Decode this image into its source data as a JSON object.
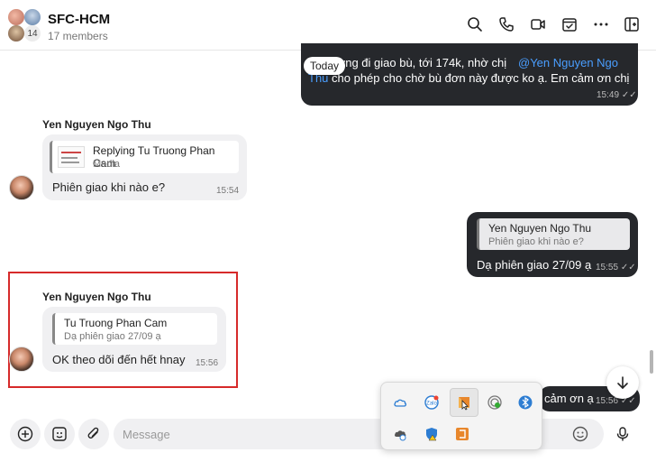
{
  "header": {
    "title": "SFC-HCM",
    "members": "17 members",
    "avatar_count": "14"
  },
  "messages": {
    "top_out": {
      "line1": "ường đi giao bù, tới 174k, nhờ chị",
      "mention1": "@Yen Nguyen Ngo",
      "mention2": "Thu",
      "line2": " cho phép cho chờ bù đơn này được ko ạ. Em cảm ơn chị",
      "time": "15:49"
    },
    "today_label": "Today",
    "msg1": {
      "sender": "Yen Nguyen Ngo Thu",
      "reply_name": "Replying Tu Truong Phan Cam",
      "reply_text": "Media",
      "text": "Phiên giao khi nào e?",
      "time": "15:54"
    },
    "msg2": {
      "reply_name": "Yen Nguyen Ngo Thu",
      "reply_text": "Phiên giao khi nào e?",
      "text": "Dạ phiên giao 27/09 ạ",
      "time": "15:55"
    },
    "msg3": {
      "sender": "Yen Nguyen Ngo Thu",
      "reply_name": "Tu Truong Phan Cam",
      "reply_text": "Dạ phiên giao 27/09 ạ",
      "text": "OK theo dõi đến hết hnay",
      "time": "15:56"
    },
    "msg4": {
      "text": "cảm ơn ạ",
      "time": "15:56"
    }
  },
  "composer": {
    "placeholder": "Message"
  },
  "colors": {
    "outgoing_bubble": "#26282c",
    "incoming_bubble": "#f0f0f2",
    "mention": "#4a9eff",
    "highlight_border": "#d62a2a"
  },
  "icons": {
    "header": [
      "search-icon",
      "phone-icon",
      "video-icon",
      "calendar-check-icon",
      "more-icon",
      "sidebar-icon"
    ],
    "composer": [
      "add-icon",
      "sticker-icon",
      "attachment-icon",
      "emoji-icon",
      "microphone-icon"
    ],
    "tray": [
      "cloud-icon",
      "zalo-icon",
      "app-icon",
      "network-icon",
      "bluetooth-icon",
      "onedrive-icon",
      "security-icon",
      "office-icon"
    ]
  }
}
